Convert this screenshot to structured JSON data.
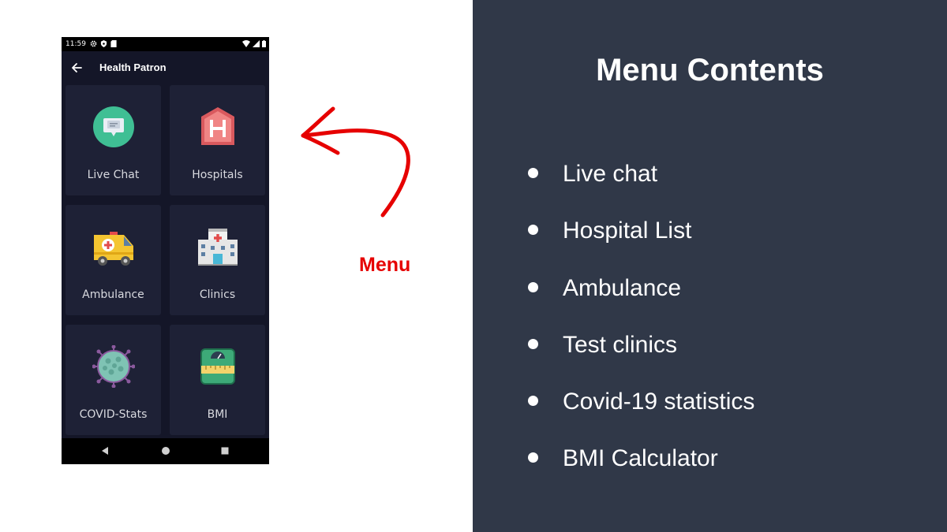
{
  "phone": {
    "status_time": "11:59",
    "app_title": "Health Patron",
    "tiles": [
      {
        "label": "Live Chat",
        "icon": "chat-bubble-icon"
      },
      {
        "label": "Hospitals",
        "icon": "hospital-h-icon"
      },
      {
        "label": "Ambulance",
        "icon": "ambulance-icon"
      },
      {
        "label": "Clinics",
        "icon": "clinic-building-icon"
      },
      {
        "label": "COVID-Stats",
        "icon": "virus-icon"
      },
      {
        "label": "BMI",
        "icon": "weighing-scale-icon"
      }
    ]
  },
  "annotation": {
    "label": "Menu",
    "color": "#e60000"
  },
  "panel": {
    "heading": "Menu Contents",
    "items": [
      "Live chat",
      "Hospital List",
      "Ambulance",
      "Test clinics",
      "Covid-19 statistics",
      "BMI Calculator"
    ],
    "background": "#303848"
  }
}
